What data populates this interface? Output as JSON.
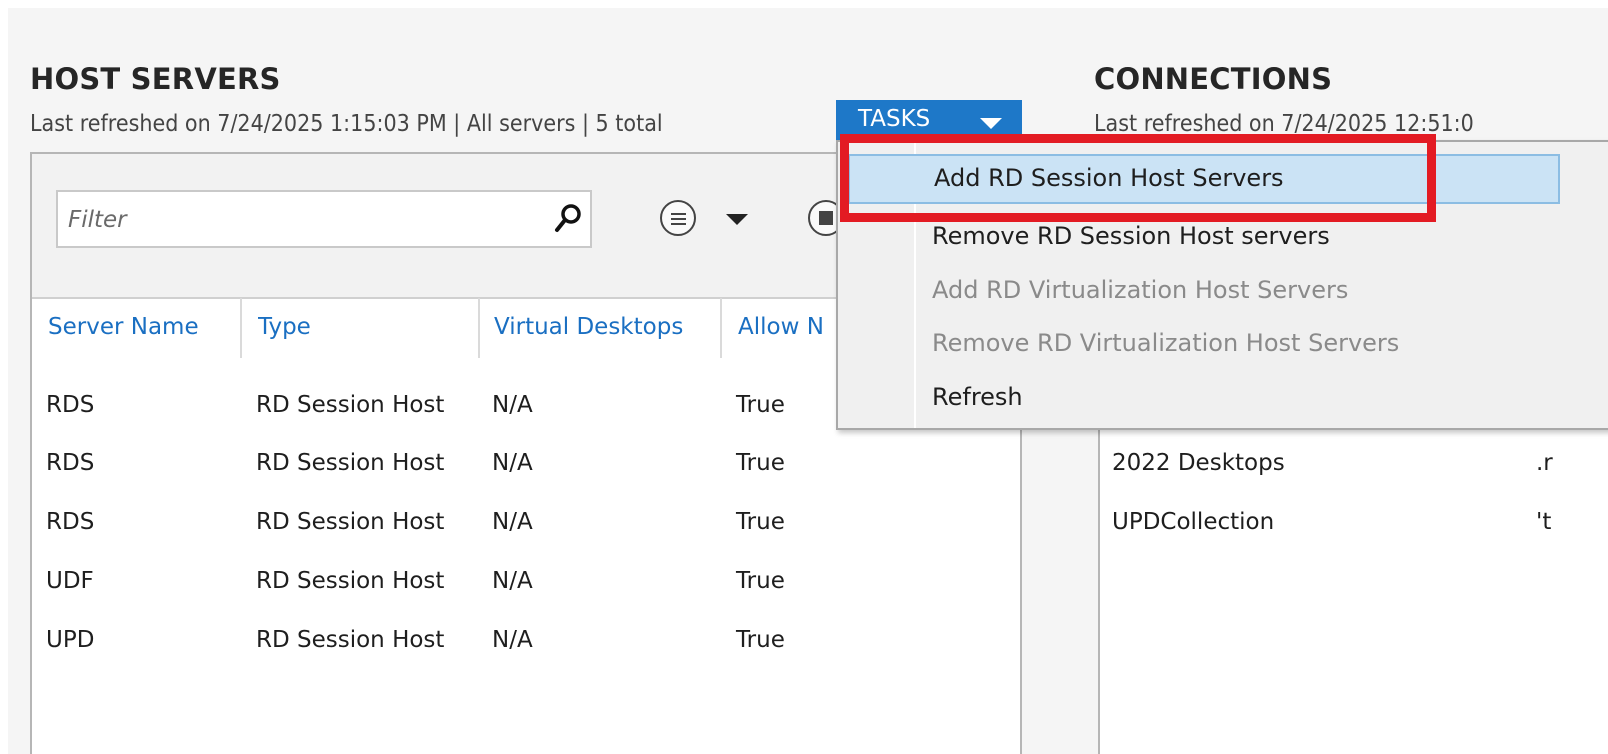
{
  "host_servers": {
    "title": "HOST SERVERS",
    "refresh_text": "Last refreshed on 7/24/2025 1:15:03 PM | All servers  | 5 total",
    "tasks_label": "TASKS",
    "filter_placeholder": "Filter",
    "columns": [
      "Server Name",
      "Type",
      "Virtual Desktops",
      "Allow N"
    ],
    "rows": [
      {
        "name": "RDS",
        "type": "RD Session Host",
        "virtual_desktops": "N/A",
        "allow": "True"
      },
      {
        "name": "RDS",
        "type": "RD Session Host",
        "virtual_desktops": "N/A",
        "allow": "True"
      },
      {
        "name": "RDS",
        "type": "RD Session Host",
        "virtual_desktops": "N/A",
        "allow": "True"
      },
      {
        "name": "UDF",
        "type": "RD Session Host",
        "virtual_desktops": "N/A",
        "allow": "True"
      },
      {
        "name": "UPD",
        "type": "RD Session Host",
        "virtual_desktops": "N/A",
        "allow": "True"
      }
    ]
  },
  "connections": {
    "title": "CONNECTIONS",
    "refresh_text": "Last refreshed on 7/24/2025 12:51:0",
    "rows": [
      {
        "name": "2022 Desktops",
        "extra": ".r"
      },
      {
        "name": "UPDCollection",
        "extra": "'t"
      }
    ]
  },
  "tasks_menu": {
    "items": [
      {
        "label": "Add RD Session Host Servers",
        "state": "highlighted"
      },
      {
        "label": "Remove RD Session Host servers",
        "state": "enabled"
      },
      {
        "label": "Add RD Virtualization Host Servers",
        "state": "disabled"
      },
      {
        "label": "Remove RD Virtualization Host Servers",
        "state": "disabled"
      },
      {
        "label": "Refresh",
        "state": "enabled"
      }
    ]
  },
  "icons": {
    "search": "magnifier-icon",
    "list_view": "list-icon",
    "dropdown": "chevron-down-icon",
    "save": "save-icon"
  },
  "colors": {
    "accent": "#1e78c8",
    "header_link": "#1a6fc2",
    "menu_highlight": "#cbe3f5",
    "annotation": "#e31b23"
  }
}
